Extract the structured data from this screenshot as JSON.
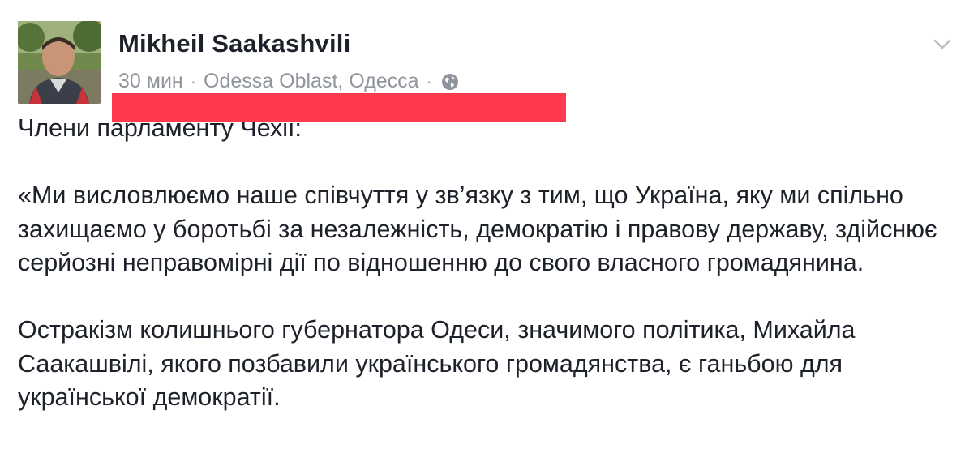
{
  "author": {
    "name": "Mikheil Saakashvili"
  },
  "meta": {
    "time": "30 мин",
    "separator": "·",
    "location": "Odessa Oblast, Одесса",
    "privacy_icon": "globe-icon"
  },
  "menu_icon": "chevron-down-icon",
  "colors": {
    "redaction": "#ff3a4d",
    "meta_text": "#90949c",
    "body_text": "#1d2129"
  },
  "post": {
    "paragraphs": [
      "Члени парламенту Чехії:",
      "«Ми висловлюємо наше співчуття у зв’язку з тим, що Україна, яку ми спільно захищаємо у боротьбі за незалежність, демократію і правову державу, здійснює серйозні неправомірні дії по відношенню до свого власного громадянина.",
      "Остракізм колишнього губернатора Одеси, значимого політика, Михайла Саакашвілі, якого позбавили українського громадянства, є ганьбою для української демократії."
    ]
  }
}
